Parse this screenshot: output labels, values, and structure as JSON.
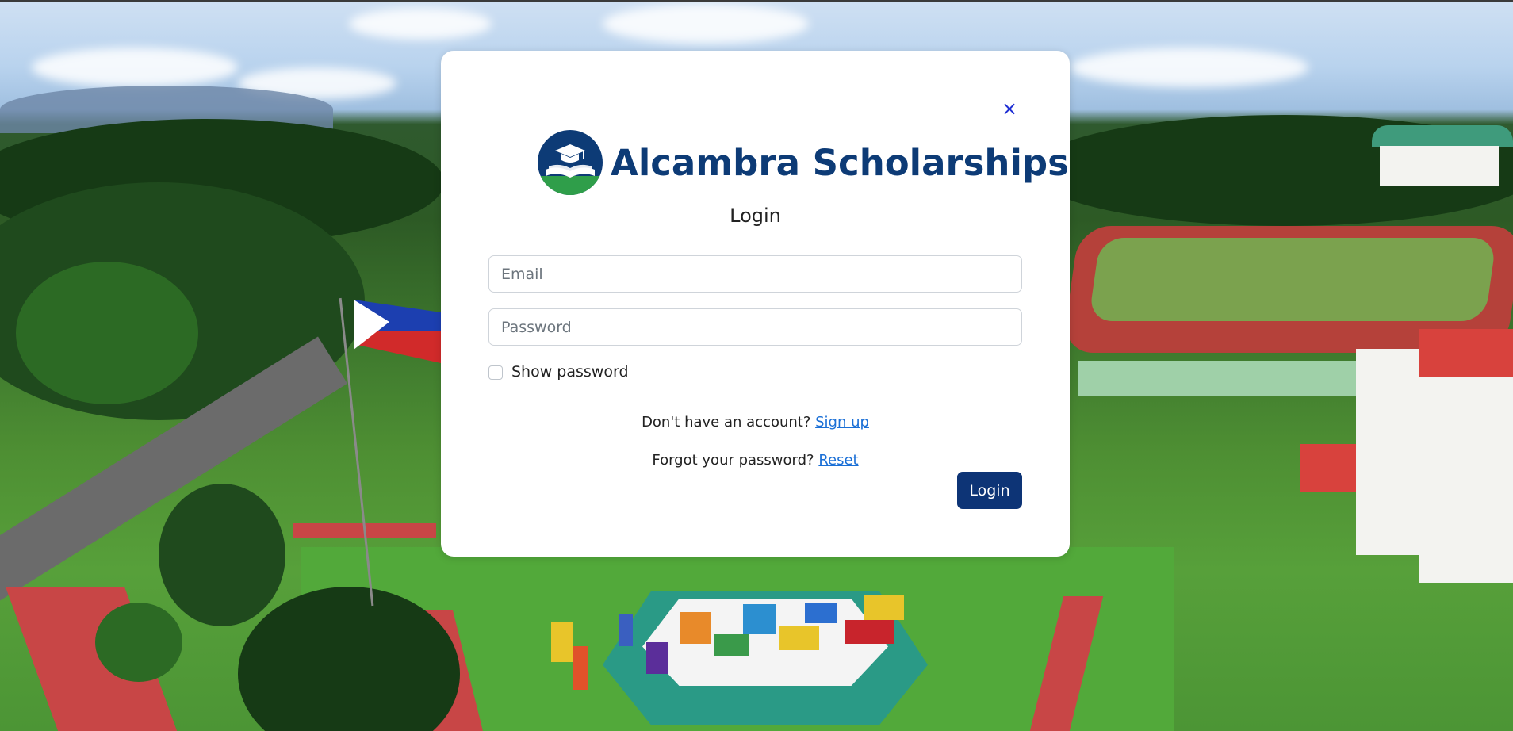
{
  "modal": {
    "close_symbol": "×",
    "brand_name": "Alcambra Scholarships",
    "title": "Login",
    "email_placeholder": "Email",
    "password_placeholder": "Password",
    "show_password_label": "Show password",
    "signup_prompt": "Don't have an account?",
    "signup_link": "Sign up",
    "reset_prompt": "Forgot your password?",
    "reset_link": "Reset",
    "login_button": "Login"
  },
  "icons": {
    "close": "close-icon",
    "logo": "graduation-cap-book-logo"
  },
  "colors": {
    "brand": "#0d3b76",
    "primary_button": "#0d3476",
    "link": "#1a6fd6",
    "close": "#1f2fd4",
    "logo_green": "#2f9e4a"
  }
}
